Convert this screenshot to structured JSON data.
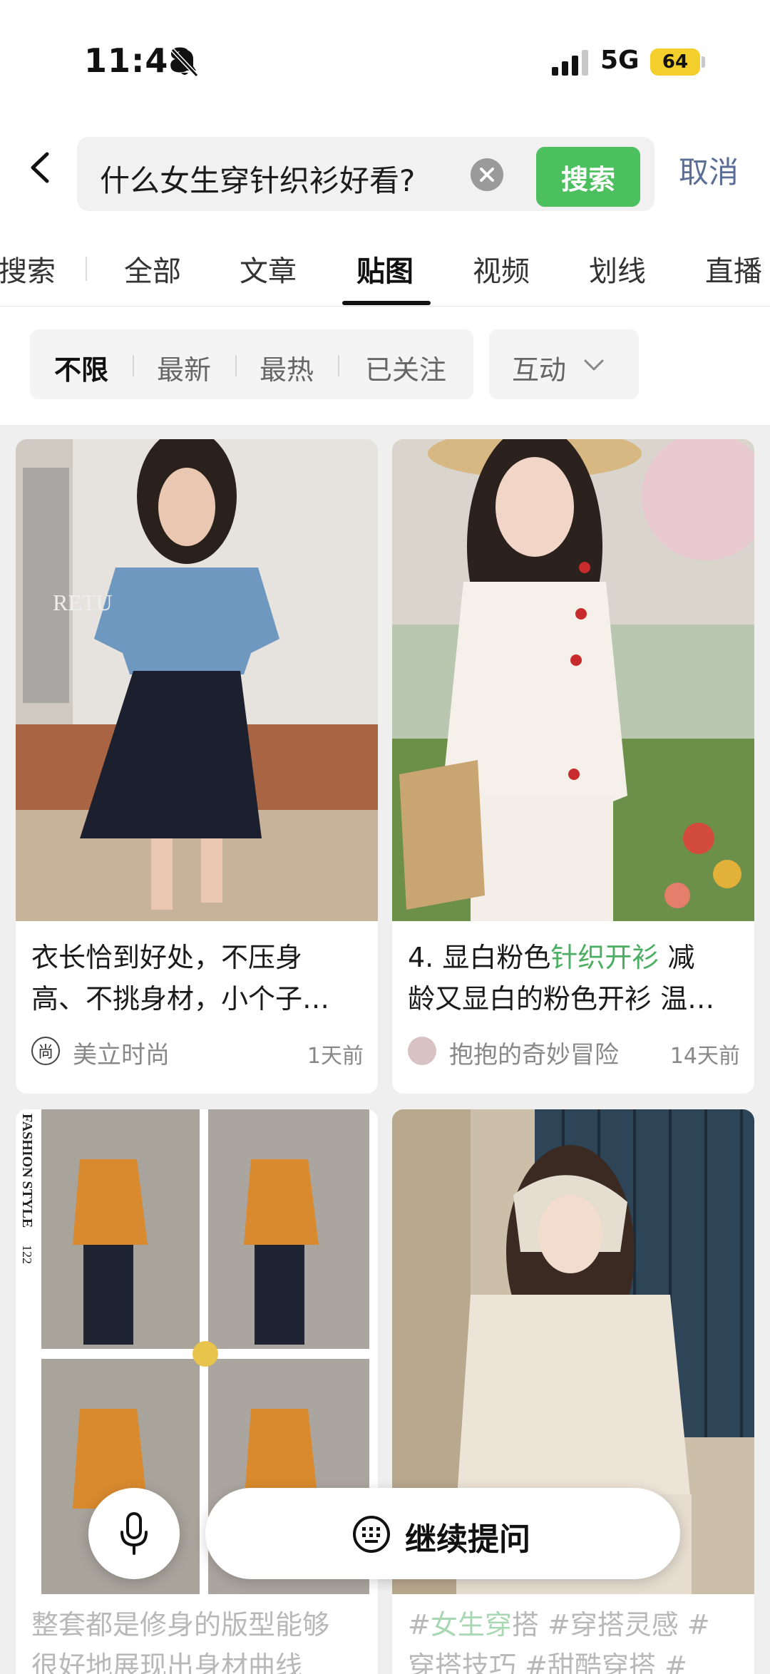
{
  "status_bar": {
    "time": "11:48",
    "network": "5G",
    "battery": "64"
  },
  "search": {
    "query": "什么女生穿针织衫好看?",
    "submit_label": "搜索",
    "cancel_label": "取消"
  },
  "tabs": [
    {
      "label": "搜索"
    },
    {
      "label": "全部"
    },
    {
      "label": "文章"
    },
    {
      "label": "贴图"
    },
    {
      "label": "视频"
    },
    {
      "label": "划线"
    },
    {
      "label": "直播"
    }
  ],
  "active_tab": "贴图",
  "filters": {
    "options": [
      {
        "label": "不限"
      },
      {
        "label": "最新"
      },
      {
        "label": "最热"
      },
      {
        "label": "已关注"
      }
    ],
    "active": "不限",
    "dropdown_label": "互动"
  },
  "cards": [
    {
      "title_line1": "衣长恰到好处，不压身",
      "title_line2": "高、不挑身材，小个子…",
      "author": "美立时尚",
      "author_badge": "尚",
      "time": "1天前"
    },
    {
      "title_line1_a": "4. 显白粉色",
      "title_line1_highlight": "针织开衫",
      "title_line1_b": " 减",
      "title_line2": "龄又显白的粉色开衫 温…",
      "author": "抱抱的奇妙冒险",
      "time": "14天前"
    },
    {
      "image_text_1": "FASHION STYLE",
      "image_text_2": "122",
      "title_line1": "整套都是修身的版型能够",
      "title_line2": "很好地展现出身材曲线"
    },
    {
      "title_line1_a": "#",
      "title_line1_highlight": "女生穿",
      "title_line1_b": "搭 #穿搭灵感 #",
      "title_line2": "穿搭技巧 #甜酷穿搭 #"
    }
  ],
  "bottom_bar": {
    "ask_label": "继续提问"
  },
  "colors": {
    "accent_green": "#4cbf5f",
    "cancel_blue": "#5b6f96",
    "battery_yellow": "#f4cf2c"
  }
}
